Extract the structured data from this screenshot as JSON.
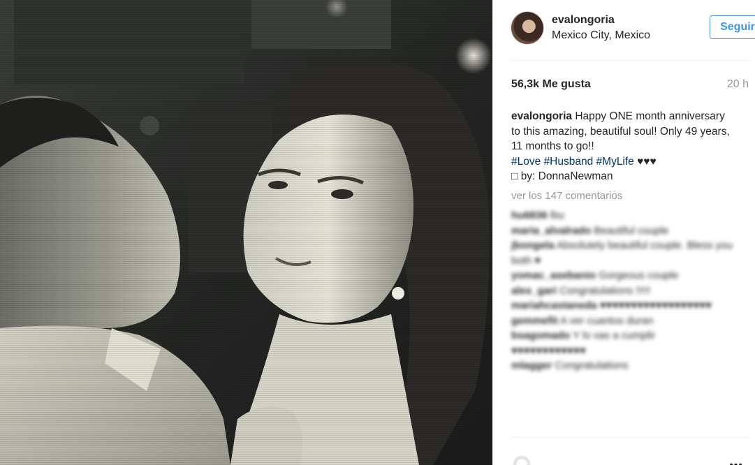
{
  "post": {
    "image_alt": "Black and white photo of a couple smiling at each other",
    "username": "evalongoria",
    "location": "Mexico City, Mexico",
    "follow_label": "Seguir",
    "likes": "56,3k Me gusta",
    "time_ago": "20 h",
    "caption": {
      "username": "evalongoria",
      "text_1": "Happy ONE month anniversary to this amazing, beautiful soul! Only 49 years, 11 months to go!!",
      "tags": [
        "#Love",
        "#Husband",
        "#MyLife"
      ],
      "hearts": "♥♥♥",
      "credit": "by: DonnaNewman",
      "credit_icon": "camera-icon"
    },
    "view_comments": "ver los 147 comentarios",
    "comments": [
      {
        "user": "hu6836",
        "text": "lbu"
      },
      {
        "user": "maria_alvalrado",
        "text": "Beautiful couple"
      },
      {
        "user": "jbongela",
        "text": "Absolutely beautiful couple. Bless you both ♥"
      },
      {
        "user": "yomac_asebanio",
        "text": "Gorgeous couple"
      },
      {
        "user": "alex_gari",
        "text": "Congratulations !!!!!"
      },
      {
        "user": "mariahcastaneda",
        "text": "♥♥♥♥♥♥♥♥♥♥♥♥♥♥♥♥♥♥"
      },
      {
        "user": "gemmefit",
        "text": "A ver cuantos duran"
      },
      {
        "user": "bsagomado",
        "text": "Y lo vas a cumplir"
      },
      {
        "user": "",
        "text": "♥♥♥♥♥♥♥♥♥♥♥♥"
      },
      {
        "user": "mlagger",
        "text": "Congratulations"
      }
    ],
    "more_options": "•••"
  }
}
